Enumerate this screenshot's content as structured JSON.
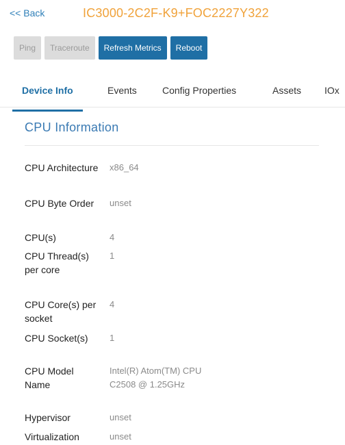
{
  "header": {
    "back_label": "<< Back",
    "device_title": "IC3000-2C2F-K9+FOC2227Y322"
  },
  "toolbar": {
    "ping_label": "Ping",
    "traceroute_label": "Traceroute",
    "refresh_label": "Refresh Metrics",
    "reboot_label": "Reboot"
  },
  "tabs": [
    {
      "label": "Device Info",
      "active": true
    },
    {
      "label": "Events"
    },
    {
      "label": "Config Properties"
    },
    {
      "label": "Assets"
    },
    {
      "label": "IOx"
    }
  ],
  "cpu_section": {
    "title": "CPU Information",
    "rows": [
      {
        "key": "CPU Architecture",
        "value": "x86_64"
      },
      {
        "key": "CPU Byte Order",
        "value": "unset"
      },
      {
        "key": "CPU(s)",
        "value": "4"
      },
      {
        "key": "CPU Thread(s) per core",
        "value": "1"
      },
      {
        "key": "CPU Core(s) per socket",
        "value": "4"
      },
      {
        "key": "CPU Socket(s)",
        "value": "1"
      },
      {
        "key": "CPU Model Name",
        "value": "Intel(R) Atom(TM) CPU C2508 @ 1.25GHz"
      },
      {
        "key": "Hypervisor",
        "value": "unset"
      },
      {
        "key": "Virtualization",
        "value": "unset"
      }
    ]
  },
  "colors": {
    "accent": "#1f6fa5",
    "title_orange": "#f0a23a",
    "link_blue": "#2e7fb8"
  }
}
